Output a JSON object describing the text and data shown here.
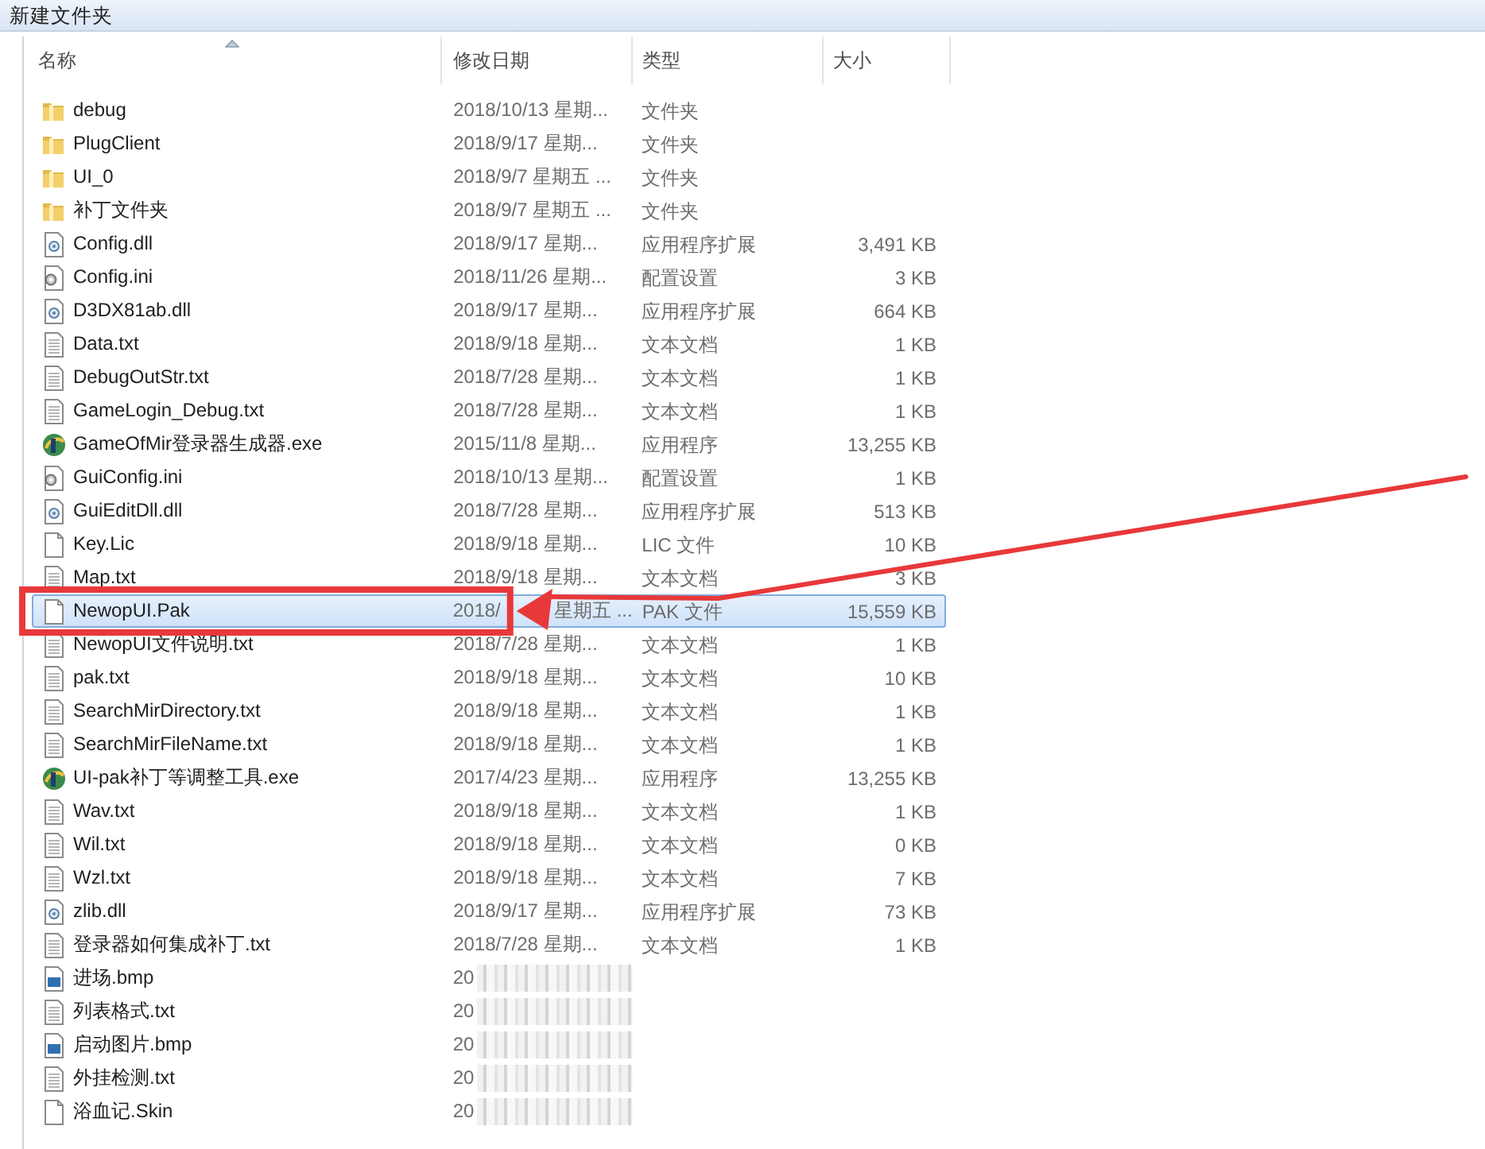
{
  "window": {
    "title": "新建文件夹"
  },
  "columns": [
    {
      "label": "名称",
      "sorted": true
    },
    {
      "label": "修改日期",
      "sorted": false
    },
    {
      "label": "类型",
      "sorted": false
    },
    {
      "label": "大小",
      "sorted": false
    }
  ],
  "rows": [
    {
      "kind": "folder",
      "name": "debug",
      "date": "2018/10/13 星期...",
      "type": "文件夹",
      "selected": false,
      "highlighted": false,
      "blurred": false
    },
    {
      "kind": "folder",
      "name": "PlugClient",
      "date": "2018/9/17 星期...",
      "type": "文件夹",
      "selected": false,
      "highlighted": false,
      "blurred": false
    },
    {
      "kind": "folder",
      "name": "UI_0",
      "date": "2018/9/7 星期五 ...",
      "type": "文件夹",
      "selected": false,
      "highlighted": false,
      "blurred": false
    },
    {
      "kind": "folder",
      "name": "补丁文件夹",
      "date": "2018/9/7 星期五 ...",
      "type": "文件夹",
      "selected": false,
      "highlighted": false,
      "blurred": false
    },
    {
      "kind": "dll",
      "name": "Config.dll",
      "date": "2018/9/17 星期...",
      "type": "应用程序扩展",
      "size": "3,491 KB",
      "selected": false,
      "highlighted": false,
      "blurred": false
    },
    {
      "kind": "ini",
      "name": "Config.ini",
      "date": "2018/11/26 星期...",
      "type": "配置设置",
      "size": "3 KB",
      "selected": false,
      "highlighted": false,
      "blurred": false
    },
    {
      "kind": "dll",
      "name": "D3DX81ab.dll",
      "date": "2018/9/17 星期...",
      "type": "应用程序扩展",
      "size": "664 KB",
      "selected": false,
      "highlighted": false,
      "blurred": false
    },
    {
      "kind": "txt",
      "name": "Data.txt",
      "date": "2018/9/18 星期...",
      "type": "文本文档",
      "size": "1 KB",
      "selected": false,
      "highlighted": false,
      "blurred": false
    },
    {
      "kind": "txt",
      "name": "DebugOutStr.txt",
      "date": "2018/7/28 星期...",
      "type": "文本文档",
      "size": "1 KB",
      "selected": false,
      "highlighted": false,
      "blurred": false
    },
    {
      "kind": "txt",
      "name": "GameLogin_Debug.txt",
      "date": "2018/7/28 星期...",
      "type": "文本文档",
      "size": "1 KB",
      "selected": false,
      "highlighted": false,
      "blurred": false
    },
    {
      "kind": "exe",
      "name": "GameOfMir登录器生成器.exe",
      "date": "2015/11/8 星期...",
      "type": "应用程序",
      "size": "13,255 KB",
      "selected": false,
      "highlighted": false,
      "blurred": false
    },
    {
      "kind": "ini",
      "name": "GuiConfig.ini",
      "date": "2018/10/13 星期...",
      "type": "配置设置",
      "size": "1 KB",
      "selected": false,
      "highlighted": false,
      "blurred": false
    },
    {
      "kind": "dll",
      "name": "GuiEditDll.dll",
      "date": "2018/7/28 星期...",
      "type": "应用程序扩展",
      "size": "513 KB",
      "selected": false,
      "highlighted": false,
      "blurred": false
    },
    {
      "kind": "blank",
      "name": "Key.Lic",
      "date": "2018/9/18 星期...",
      "type": "LIC 文件",
      "size": "10 KB",
      "selected": false,
      "highlighted": false,
      "blurred": false
    },
    {
      "kind": "txt",
      "name": "Map.txt",
      "date": "2018/9/18 星期...",
      "type": "文本文档",
      "size": "3 KB",
      "selected": false,
      "highlighted": false,
      "blurred": false
    },
    {
      "kind": "blank",
      "name": "NewopUI.Pak",
      "date": "2018/",
      "date_tail": "星期五 ...",
      "type": "PAK 文件",
      "size": "15,559 KB",
      "selected": true,
      "highlighted": true,
      "blurred": false
    },
    {
      "kind": "txt",
      "name": "NewopUI文件说明.txt",
      "date": "2018/7/28 星期...",
      "type": "文本文档",
      "size": "1 KB",
      "selected": false,
      "highlighted": false,
      "blurred": false
    },
    {
      "kind": "txt",
      "name": "pak.txt",
      "date": "2018/9/18 星期...",
      "type": "文本文档",
      "size": "10 KB",
      "selected": false,
      "highlighted": false,
      "blurred": false
    },
    {
      "kind": "txt",
      "name": "SearchMirDirectory.txt",
      "date": "2018/9/18 星期...",
      "type": "文本文档",
      "size": "1 KB",
      "selected": false,
      "highlighted": false,
      "blurred": false
    },
    {
      "kind": "txt",
      "name": "SearchMirFileName.txt",
      "date": "2018/9/18 星期...",
      "type": "文本文档",
      "size": "1 KB",
      "selected": false,
      "highlighted": false,
      "blurred": false
    },
    {
      "kind": "exe",
      "name": "UI-pak补丁等调整工具.exe",
      "date": "2017/4/23 星期...",
      "type": "应用程序",
      "size": "13,255 KB",
      "selected": false,
      "highlighted": false,
      "blurred": false
    },
    {
      "kind": "txt",
      "name": "Wav.txt",
      "date": "2018/9/18 星期...",
      "type": "文本文档",
      "size": "1 KB",
      "selected": false,
      "highlighted": false,
      "blurred": false
    },
    {
      "kind": "txt",
      "name": "Wil.txt",
      "date": "2018/9/18 星期...",
      "type": "文本文档",
      "size": "0 KB",
      "selected": false,
      "highlighted": false,
      "blurred": false
    },
    {
      "kind": "txt",
      "name": "Wzl.txt",
      "date": "2018/9/18 星期...",
      "type": "文本文档",
      "size": "7 KB",
      "selected": false,
      "highlighted": false,
      "blurred": false
    },
    {
      "kind": "dll",
      "name": "zlib.dll",
      "date": "2018/9/17 星期...",
      "type": "应用程序扩展",
      "size": "73 KB",
      "selected": false,
      "highlighted": false,
      "blurred": false
    },
    {
      "kind": "txt",
      "name": "登录器如何集成补丁.txt",
      "date": "2018/7/28 星期...",
      "type": "文本文档",
      "size": "1 KB",
      "selected": false,
      "highlighted": false,
      "blurred": false
    },
    {
      "kind": "bmp",
      "name": "进场.bmp",
      "date": "20",
      "selected": false,
      "highlighted": false,
      "blurred": true
    },
    {
      "kind": "txt",
      "name": "列表格式.txt",
      "date": "20",
      "selected": false,
      "highlighted": false,
      "blurred": true
    },
    {
      "kind": "bmp",
      "name": "启动图片.bmp",
      "date": "20",
      "selected": false,
      "highlighted": false,
      "blurred": true
    },
    {
      "kind": "txt",
      "name": "外挂检测.txt",
      "date": "20",
      "selected": false,
      "highlighted": false,
      "blurred": true
    },
    {
      "kind": "blank",
      "name": "浴血记.Skin",
      "date": "20",
      "selected": false,
      "highlighted": false,
      "blurred": true
    }
  ]
}
